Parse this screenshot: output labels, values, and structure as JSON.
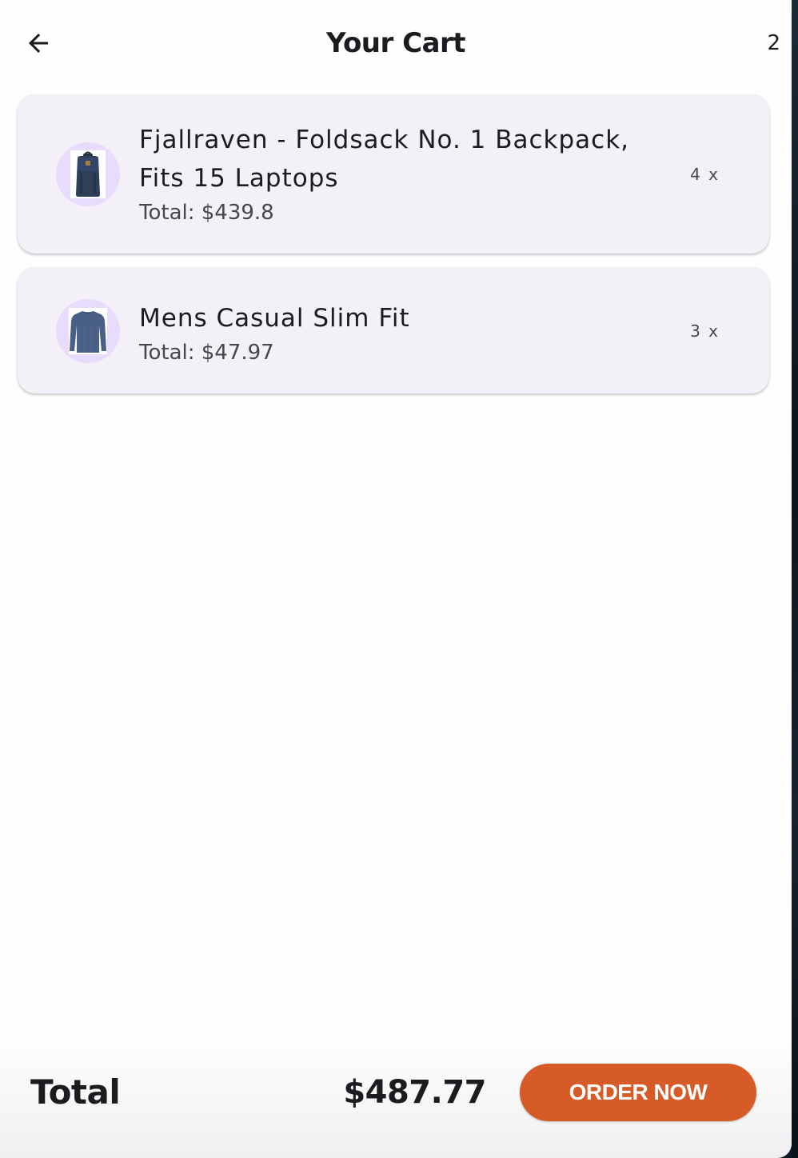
{
  "appbar": {
    "title": "Your Cart",
    "count": "2",
    "back_icon": "arrow-left-icon"
  },
  "cart": {
    "items": [
      {
        "title": "Fjallraven - Foldsack No. 1 Backpack, Fits 15 Laptops",
        "total": "Total: $439.8",
        "quantity": "4 x",
        "image_icon": "backpack-thumbnail"
      },
      {
        "title": "Mens Casual Slim Fit",
        "total": "Total: $47.97",
        "quantity": "3 x",
        "image_icon": "long-sleeve-shirt-thumbnail"
      }
    ]
  },
  "footer": {
    "total_label": "Total",
    "total_value": "$487.77",
    "order_button_label": "ORDER NOW"
  },
  "colors": {
    "background": "#fffefe",
    "card": "#f4f0f8",
    "avatar": "#e7dcfb",
    "accent": "#d65b27",
    "text": "#1c1b1f",
    "muted": "#49454f"
  }
}
